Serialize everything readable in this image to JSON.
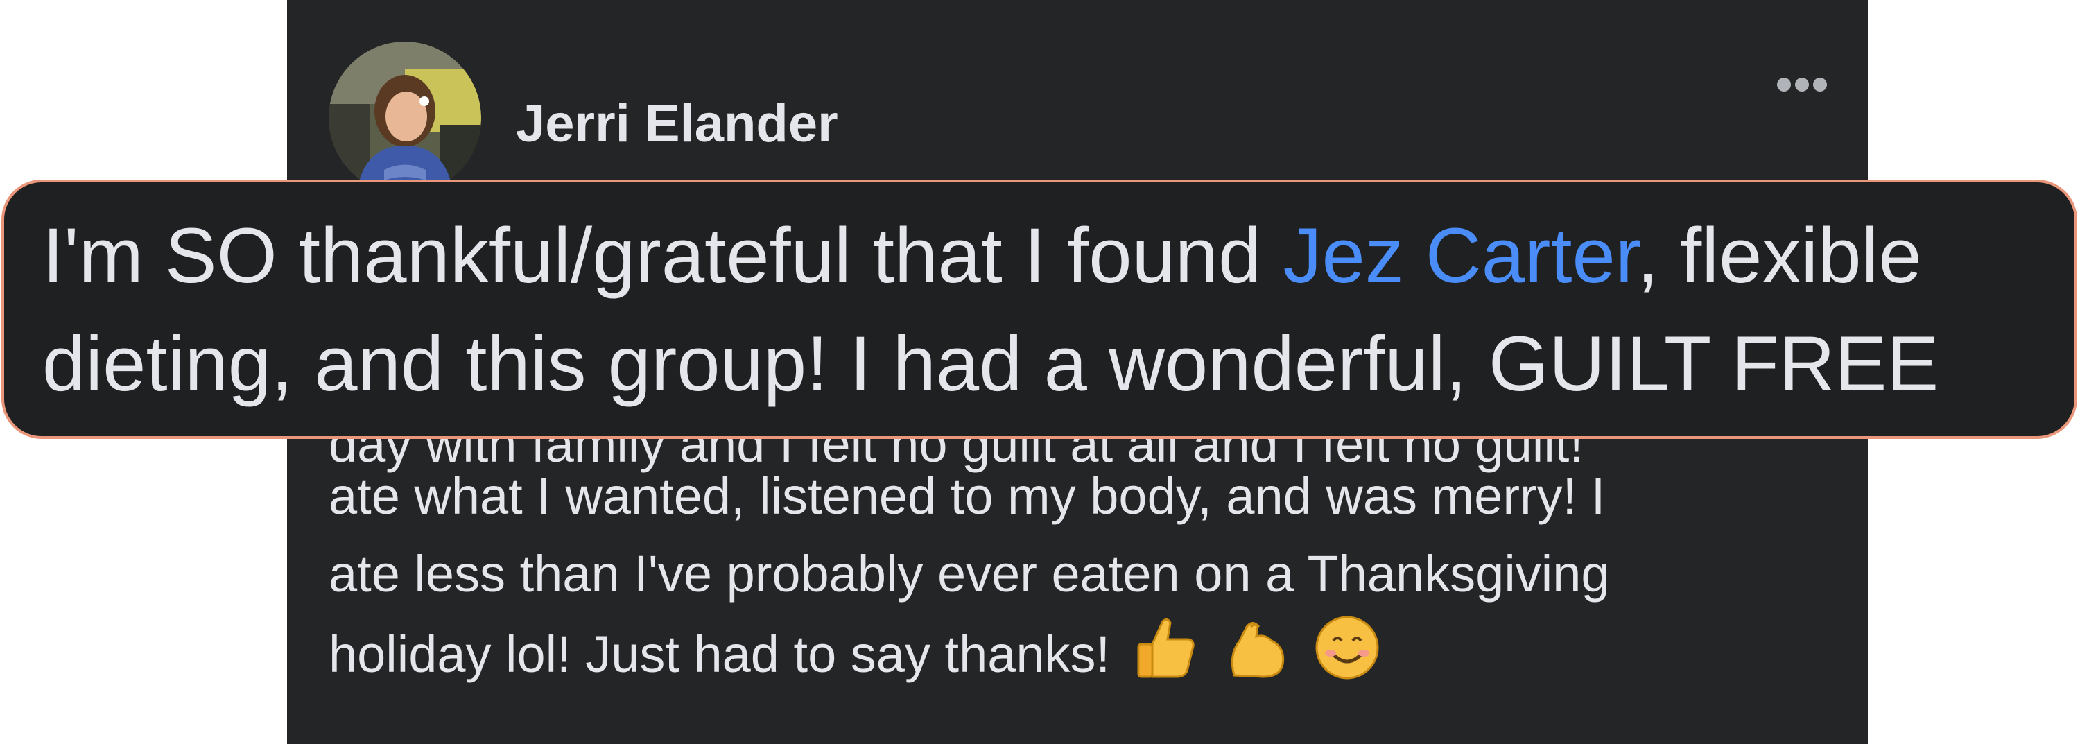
{
  "post": {
    "author": "Jerri Elander",
    "avatar_icon": "profile-photo",
    "more_icon": "more-horizontal-icon",
    "hidden_line": "day with family and I felt no guilt at all and I felt no guilt!",
    "body_lines": [
      "ate what I wanted, listened to my body, and was merry! I",
      "ate less than I've probably ever eaten on a Thanksgiving",
      "holiday lol! Just had to say thanks!"
    ],
    "emojis": [
      "thumbs-up",
      "flexed-biceps",
      "smiling-face"
    ]
  },
  "zoom": {
    "line1_before": "I'm SO thankful/grateful that I found ",
    "mention": "Jez Carter",
    "line1_after": ", flexible",
    "line2": "dieting, and this group! I had a wonderful, GUILT FREE",
    "line3": "day with family and I felt no guilt at all and I felt no guilt!"
  },
  "colors": {
    "card_bg": "#242526",
    "text": "#e4e6eb",
    "mention": "#4b8df8",
    "callout_border": "#e9967a"
  }
}
